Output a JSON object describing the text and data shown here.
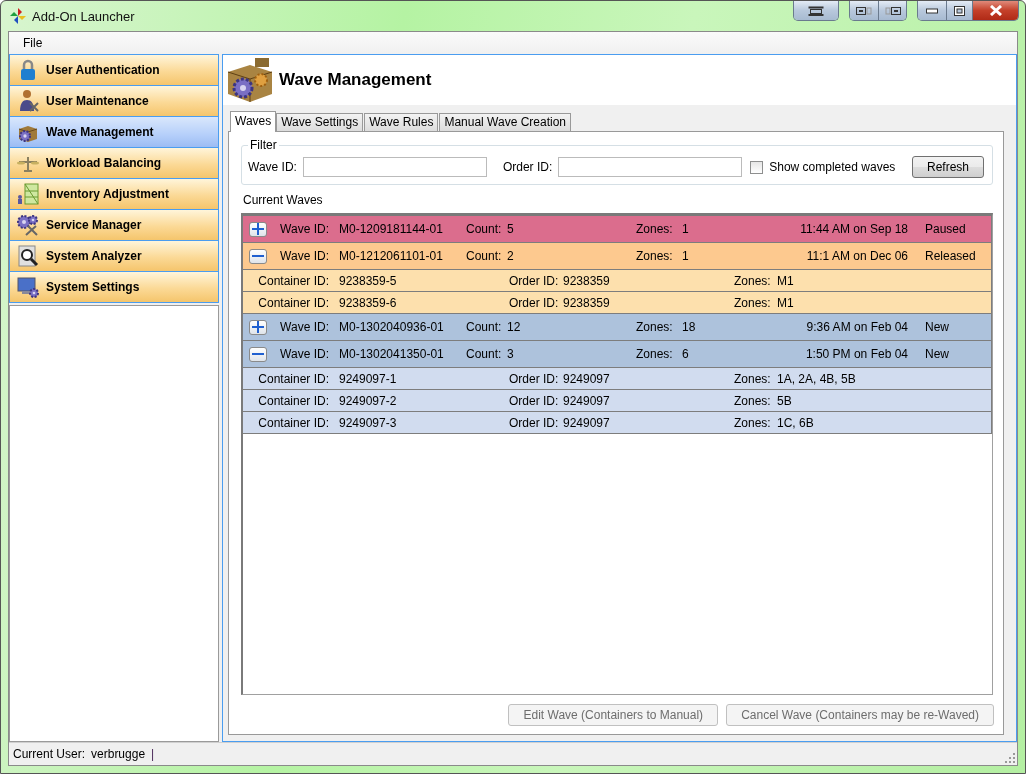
{
  "window": {
    "title": "Add-On Launcher"
  },
  "menu": [
    {
      "label": "File"
    }
  ],
  "sidebar": {
    "items": [
      {
        "label": "User Authentication",
        "selected": false
      },
      {
        "label": "User Maintenance",
        "selected": false
      },
      {
        "label": "Wave Management",
        "selected": true
      },
      {
        "label": "Workload Balancing",
        "selected": false
      },
      {
        "label": "Inventory Adjustment",
        "selected": false
      },
      {
        "label": "Service Manager",
        "selected": false
      },
      {
        "label": "System Analyzer",
        "selected": false
      },
      {
        "label": "System Settings",
        "selected": false
      }
    ]
  },
  "page": {
    "title": "Wave Management"
  },
  "tabs": [
    {
      "label": "Waves",
      "selected": true
    },
    {
      "label": "Wave Settings",
      "selected": false
    },
    {
      "label": "Wave Rules",
      "selected": false
    },
    {
      "label": "Manual Wave Creation",
      "selected": false
    }
  ],
  "filter": {
    "title": "Filter",
    "wave_id_label": "Wave ID:",
    "order_id_label": "Order ID:",
    "show_completed": {
      "label": "Show completed waves",
      "checked": false
    },
    "refresh": "Refresh"
  },
  "current_waves_label": "Current Waves",
  "waves": [
    {
      "color": "#db6d8d",
      "expanded": false,
      "wave_id_label": "Wave ID:",
      "wave_id": "M0-1209181144-01",
      "count_label": "Count:",
      "count": "5",
      "zones_label": "Zones:",
      "zones": "1",
      "time": "11:44 AM on Sep 18",
      "status": "Paused"
    },
    {
      "color": "#fdc98f",
      "expanded": true,
      "wave_id_label": "Wave ID:",
      "wave_id": "M0-1212061101-01",
      "count_label": "Count:",
      "count": "2",
      "zones_label": "Zones:",
      "zones": "1",
      "time": "11:1 AM on Dec 06",
      "status": "Released",
      "containers": [
        {
          "color": "#fde0ad",
          "container_label": "Container ID:",
          "container_id": "9238359-5",
          "order_label": "Order ID:",
          "order_id": "9238359",
          "zones_label": "Zones:",
          "zones": "M1"
        },
        {
          "color": "#fde0ad",
          "container_label": "Container ID:",
          "container_id": "9238359-6",
          "order_label": "Order ID:",
          "order_id": "9238359",
          "zones_label": "Zones:",
          "zones": "M1"
        }
      ]
    },
    {
      "color": "#adc2dc",
      "expanded": false,
      "wave_id_label": "Wave ID:",
      "wave_id": "M0-1302040936-01",
      "count_label": "Count:",
      "count": "12",
      "zones_label": "Zones:",
      "zones": "18",
      "time": "9:36 AM on Feb 04",
      "status": "New"
    },
    {
      "color": "#adc2dc",
      "expanded": true,
      "wave_id_label": "Wave ID:",
      "wave_id": "M0-1302041350-01",
      "count_label": "Count:",
      "count": "3",
      "zones_label": "Zones:",
      "zones": "6",
      "time": "1:50 PM on Feb 04",
      "status": "New",
      "containers": [
        {
          "color": "#d1dcef",
          "container_label": "Container ID:",
          "container_id": "9249097-1",
          "order_label": "Order ID:",
          "order_id": "9249097",
          "zones_label": "Zones:",
          "zones": "1A, 2A, 4B, 5B"
        },
        {
          "color": "#d1dcef",
          "container_label": "Container ID:",
          "container_id": "9249097-2",
          "order_label": "Order ID:",
          "order_id": "9249097",
          "zones_label": "Zones:",
          "zones": "5B"
        },
        {
          "color": "#d1dcef",
          "container_label": "Container ID:",
          "container_id": "9249097-3",
          "order_label": "Order ID:",
          "order_id": "9249097",
          "zones_label": "Zones:",
          "zones": "1C, 6B"
        }
      ]
    }
  ],
  "actions": [
    {
      "label": "Edit Wave (Containers to Manual)",
      "disabled": true
    },
    {
      "label": "Cancel Wave (Containers may be re-Waved)",
      "disabled": true
    }
  ],
  "status_bar": {
    "label": "Current User:",
    "user": "verbrugge",
    "separator": "|"
  }
}
